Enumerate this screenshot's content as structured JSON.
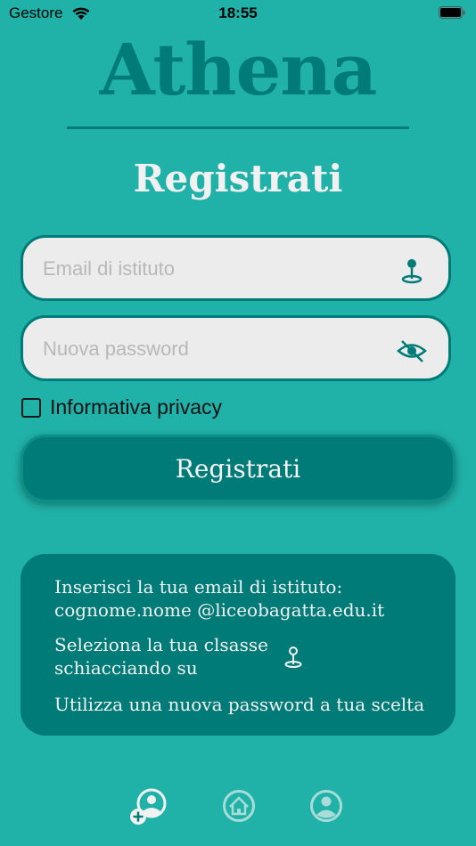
{
  "status_bar": {
    "carrier": "Gestore",
    "time": "18:55"
  },
  "app": {
    "logo": "Athena",
    "title": "Registrati"
  },
  "form": {
    "email_placeholder": "Email di istituto",
    "password_placeholder": "Nuova password",
    "privacy_label": "Informativa privacy",
    "privacy_checked": false,
    "submit_label": "Registrati"
  },
  "info": {
    "line1": "Inserisci la tua email di istituto:",
    "line2": "cognome.nome @liceobagatta.edu.it",
    "line3": "Seleziona la tua clsasse",
    "line4": "schiacciando su",
    "line5": "Utilizza una nuova password a tua scelta"
  },
  "icons": {
    "email_field": "location-pin-icon",
    "password_field": "eye-slash-icon",
    "info": "location-pin-icon",
    "nav": [
      "add-user-icon",
      "home-icon",
      "profile-icon"
    ]
  },
  "colors": {
    "background": "#20b2a8",
    "accent": "#007b78",
    "field_bg": "#ececec",
    "text_light": "#f2f2f2"
  }
}
